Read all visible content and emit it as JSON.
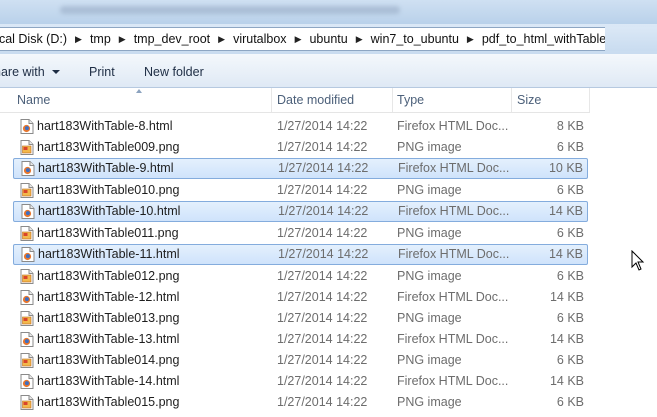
{
  "address": {
    "crumbs": [
      "ocal Disk (D:)",
      "tmp",
      "tmp_dev_root",
      "virutalbox",
      "ubuntu",
      "win7_to_ubuntu",
      "pdf_to_html_withTable"
    ]
  },
  "toolbar": {
    "share_label": "hare with",
    "print_label": "Print",
    "new_folder_label": "New folder"
  },
  "columns": {
    "name": "Name",
    "date": "Date modified",
    "type": "Type",
    "size": "Size"
  },
  "files": [
    {
      "name": "hart183WithTable-8.html",
      "date": "1/27/2014 14:22",
      "type": "Firefox HTML Doc...",
      "size": "8 KB",
      "icon": "firefox-html-icon",
      "selected": false
    },
    {
      "name": "hart183WithTable009.png",
      "date": "1/27/2014 14:22",
      "type": "PNG image",
      "size": "6 KB",
      "icon": "png-image-icon",
      "selected": false
    },
    {
      "name": "hart183WithTable-9.html",
      "date": "1/27/2014 14:22",
      "type": "Firefox HTML Doc...",
      "size": "10 KB",
      "icon": "firefox-html-icon",
      "selected": true
    },
    {
      "name": "hart183WithTable010.png",
      "date": "1/27/2014 14:22",
      "type": "PNG image",
      "size": "6 KB",
      "icon": "png-image-icon",
      "selected": false
    },
    {
      "name": "hart183WithTable-10.html",
      "date": "1/27/2014 14:22",
      "type": "Firefox HTML Doc...",
      "size": "14 KB",
      "icon": "firefox-html-icon",
      "selected": true
    },
    {
      "name": "hart183WithTable011.png",
      "date": "1/27/2014 14:22",
      "type": "PNG image",
      "size": "6 KB",
      "icon": "png-image-icon",
      "selected": false
    },
    {
      "name": "hart183WithTable-11.html",
      "date": "1/27/2014 14:22",
      "type": "Firefox HTML Doc...",
      "size": "14 KB",
      "icon": "firefox-html-icon",
      "selected": true
    },
    {
      "name": "hart183WithTable012.png",
      "date": "1/27/2014 14:22",
      "type": "PNG image",
      "size": "6 KB",
      "icon": "png-image-icon",
      "selected": false
    },
    {
      "name": "hart183WithTable-12.html",
      "date": "1/27/2014 14:22",
      "type": "Firefox HTML Doc...",
      "size": "14 KB",
      "icon": "firefox-html-icon",
      "selected": false
    },
    {
      "name": "hart183WithTable013.png",
      "date": "1/27/2014 14:22",
      "type": "PNG image",
      "size": "6 KB",
      "icon": "png-image-icon",
      "selected": false
    },
    {
      "name": "hart183WithTable-13.html",
      "date": "1/27/2014 14:22",
      "type": "Firefox HTML Doc...",
      "size": "14 KB",
      "icon": "firefox-html-icon",
      "selected": false
    },
    {
      "name": "hart183WithTable014.png",
      "date": "1/27/2014 14:22",
      "type": "PNG image",
      "size": "6 KB",
      "icon": "png-image-icon",
      "selected": false
    },
    {
      "name": "hart183WithTable-14.html",
      "date": "1/27/2014 14:22",
      "type": "Firefox HTML Doc...",
      "size": "14 KB",
      "icon": "firefox-html-icon",
      "selected": false
    },
    {
      "name": "hart183WithTable015.png",
      "date": "1/27/2014 14:22",
      "type": "PNG image",
      "size": "6 KB",
      "icon": "png-image-icon",
      "selected": false
    }
  ],
  "colors": {
    "selection_border": "#84acdd",
    "selection_fill": "#cfe3fb",
    "header_text": "#4c607a"
  }
}
